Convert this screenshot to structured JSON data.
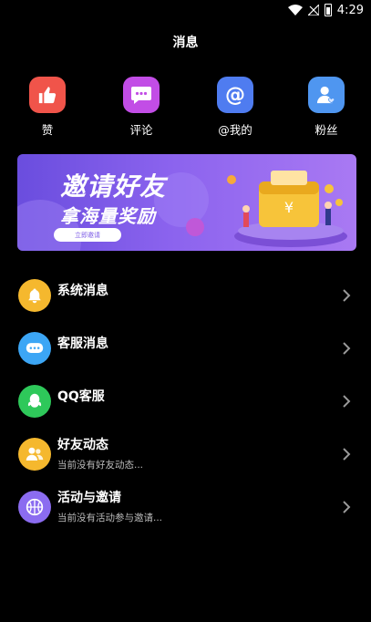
{
  "status_bar": {
    "time": "4:29"
  },
  "page": {
    "title": "消息"
  },
  "quick_actions": [
    {
      "label": "赞",
      "icon": "thumbs-up-icon",
      "color": "#f0544a"
    },
    {
      "label": "评论",
      "icon": "comment-icon",
      "color": "#c24de6"
    },
    {
      "label": "@我的",
      "icon": "at-icon",
      "color": "#4f7cf0"
    },
    {
      "label": "粉丝",
      "icon": "fan-user-icon",
      "color": "#4f96f0"
    }
  ],
  "banner": {
    "title": "邀请好友",
    "subtitle": "拿海量奖励",
    "button_label": "立即邀请",
    "wallet_symbol": "¥",
    "colors": {
      "start": "#6a4dde",
      "end": "#a979f3"
    }
  },
  "messages": [
    {
      "title": "系统消息",
      "subtitle": "",
      "icon": "bell-icon",
      "color": "#f5b82e"
    },
    {
      "title": "客服消息",
      "subtitle": "",
      "icon": "chat-bubble-icon",
      "color": "#3ca6f5"
    },
    {
      "title": "QQ客服",
      "subtitle": "",
      "icon": "qq-icon",
      "color": "#2ec85a"
    },
    {
      "title": "好友动态",
      "subtitle": "当前没有好友动态...",
      "icon": "friends-icon",
      "color": "#f5b82e"
    },
    {
      "title": "活动与邀请",
      "subtitle": "当前没有活动参与邀请...",
      "icon": "basketball-icon",
      "color": "#8b6cf0"
    }
  ]
}
